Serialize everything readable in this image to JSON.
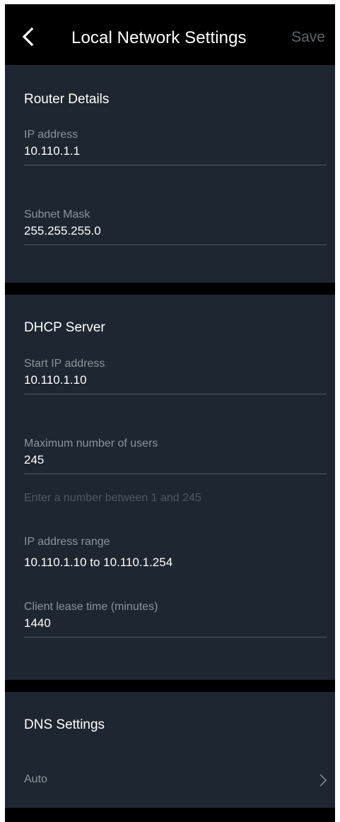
{
  "header": {
    "title": "Local Network Settings",
    "save_label": "Save",
    "back_icon": "chevron-left-icon"
  },
  "router_details": {
    "title": "Router Details",
    "ip_address": {
      "label": "IP address",
      "value": "10.110.1.1"
    },
    "subnet_mask": {
      "label": "Subnet Mask",
      "value": "255.255.255.0"
    }
  },
  "dhcp_server": {
    "title": "DHCP Server",
    "start_ip": {
      "label": "Start IP address",
      "value": "10.110.1.10"
    },
    "max_users": {
      "label": "Maximum number of users",
      "value": "245",
      "hint": "Enter a number between 1 and 245"
    },
    "ip_range": {
      "label": "IP address range",
      "value": "10.110.1.10 to 10.110.1.254"
    },
    "lease_time": {
      "label": "Client lease time (minutes)",
      "value": "1440"
    }
  },
  "dns_settings": {
    "title": "DNS Settings",
    "value": "Auto",
    "icon": "chevron-right-icon"
  },
  "colors": {
    "background": "#000000",
    "section_bg": "#1e2731",
    "text_primary": "#ffffff",
    "text_secondary": "#8b939c",
    "text_muted": "#4f5862",
    "save_disabled": "#5f6770",
    "underline": "#4e5864"
  }
}
